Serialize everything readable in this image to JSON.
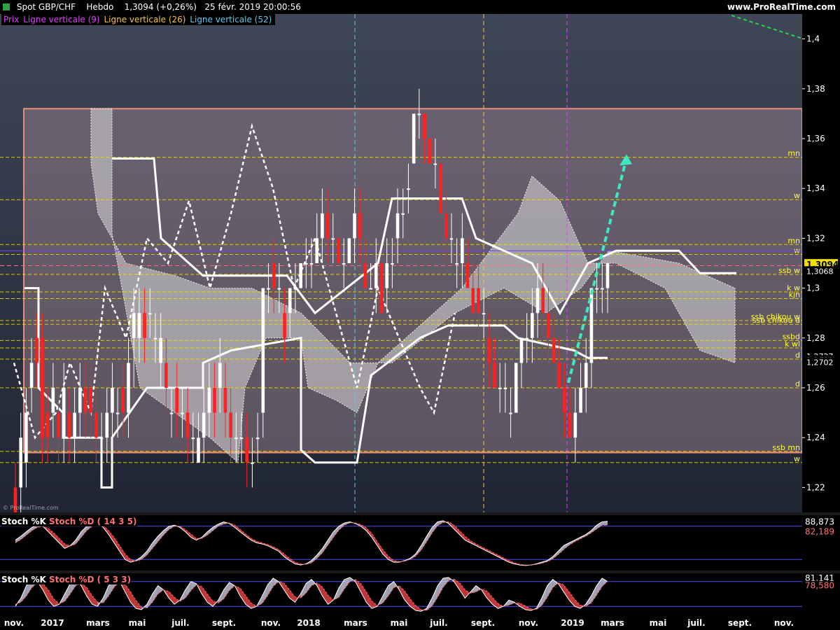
{
  "header": {
    "title": "Spot GBP/CHF",
    "period": "Hebdo",
    "last": "1,3094 (+0,26%)",
    "datetime": "25 févr. 2019 20:00:56",
    "brand": "www.ProRealTime.com"
  },
  "legend": [
    {
      "label": "Prix",
      "color": "#e040fb"
    },
    {
      "label": "Ligne verticale (9)",
      "color": "#e040fb"
    },
    {
      "label": "Ligne verticale (26)",
      "color": "#f4c542"
    },
    {
      "label": "Ligne verticale (52)",
      "color": "#5ec8f2"
    }
  ],
  "watermark": "© ProRealTime.com",
  "colors": {
    "up_candle": "#ffffff",
    "down_candle": "#ff2020",
    "box_border": "#f08a7a",
    "level_line": "#f4e000",
    "stoch_k": "#ffffff",
    "stoch_d": "#ff6060",
    "projection": "#3ee8c0"
  },
  "x_labels": [
    "nov.",
    "2017",
    "mars",
    "mai",
    "juil.",
    "sept.",
    "nov.",
    "2018",
    "mars",
    "mai",
    "juil.",
    "sept.",
    "nov.",
    "2019",
    "mars",
    "mai",
    "juil.",
    "sept.",
    "nov."
  ],
  "price_axis": {
    "ticks": [
      "1,4",
      "1,38",
      "1,36",
      "1,34",
      "1,32",
      "1,3",
      "1,28",
      "1,26",
      "1,24",
      "1,22"
    ],
    "ylim": [
      1.21,
      1.41
    ],
    "current_price_label": "1,3094",
    "side_labels": [
      "1,3068",
      "1,2727",
      "1,2711",
      "1,2702"
    ]
  },
  "level_labels": [
    {
      "text": "mn",
      "value": 1.3525
    },
    {
      "text": "w",
      "value": 1.3355
    },
    {
      "text": "mn",
      "value": 1.3175
    },
    {
      "text": "w",
      "value": 1.3135
    },
    {
      "text": "ssb w",
      "value": 1.3055
    },
    {
      "text": "k w",
      "value": 1.2985
    },
    {
      "text": "kjn",
      "value": 1.2958
    },
    {
      "text": "ssb chikou w",
      "value": 1.287
    },
    {
      "text": "ssb chikou d",
      "value": 1.2855
    },
    {
      "text": "ssbd",
      "value": 1.279
    },
    {
      "text": "k wl",
      "value": 1.276
    },
    {
      "text": "d",
      "value": 1.2715
    },
    {
      "text": "d",
      "value": 1.26
    },
    {
      "text": "ssb mn",
      "value": 1.2345
    },
    {
      "text": "w",
      "value": 1.23
    }
  ],
  "chart_data": [
    {
      "type": "candlestick",
      "title": "Spot GBP/CHF",
      "ylim": [
        1.21,
        1.41
      ],
      "box": {
        "top": 1.372,
        "bottom": 1.234
      },
      "candles": [
        [
          1.22,
          1.23,
          1.2,
          1.21
        ],
        [
          1.22,
          1.25,
          1.19,
          1.24
        ],
        [
          1.23,
          1.26,
          1.22,
          1.25
        ],
        [
          1.26,
          1.28,
          1.25,
          1.27
        ],
        [
          1.28,
          1.29,
          1.26,
          1.27
        ],
        [
          1.28,
          1.29,
          1.23,
          1.24
        ],
        [
          1.25,
          1.26,
          1.23,
          1.24
        ],
        [
          1.25,
          1.27,
          1.24,
          1.26
        ],
        [
          1.25,
          1.26,
          1.23,
          1.24
        ],
        [
          1.24,
          1.27,
          1.23,
          1.26
        ],
        [
          1.25,
          1.26,
          1.23,
          1.24
        ],
        [
          1.24,
          1.26,
          1.23,
          1.25
        ],
        [
          1.25,
          1.27,
          1.24,
          1.26
        ],
        [
          1.26,
          1.27,
          1.24,
          1.25
        ],
        [
          1.26,
          1.27,
          1.24,
          1.25
        ],
        [
          1.25,
          1.26,
          1.23,
          1.24
        ],
        [
          1.24,
          1.25,
          1.23,
          1.24
        ],
        [
          1.24,
          1.26,
          1.23,
          1.25
        ],
        [
          1.25,
          1.27,
          1.23,
          1.26
        ],
        [
          1.25,
          1.26,
          1.24,
          1.25
        ],
        [
          1.26,
          1.27,
          1.24,
          1.25
        ],
        [
          1.25,
          1.28,
          1.24,
          1.27
        ],
        [
          1.28,
          1.3,
          1.26,
          1.29
        ],
        [
          1.28,
          1.3,
          1.27,
          1.29
        ],
        [
          1.29,
          1.3,
          1.27,
          1.28
        ],
        [
          1.29,
          1.3,
          1.28,
          1.29
        ],
        [
          1.28,
          1.29,
          1.27,
          1.28
        ],
        [
          1.27,
          1.29,
          1.26,
          1.28
        ],
        [
          1.27,
          1.28,
          1.25,
          1.26
        ],
        [
          1.25,
          1.26,
          1.24,
          1.25
        ],
        [
          1.26,
          1.27,
          1.24,
          1.25
        ],
        [
          1.25,
          1.26,
          1.24,
          1.25
        ],
        [
          1.25,
          1.26,
          1.23,
          1.24
        ],
        [
          1.24,
          1.25,
          1.23,
          1.24
        ],
        [
          1.23,
          1.25,
          1.23,
          1.24
        ],
        [
          1.24,
          1.26,
          1.23,
          1.25
        ],
        [
          1.25,
          1.27,
          1.24,
          1.26
        ],
        [
          1.26,
          1.27,
          1.24,
          1.25
        ],
        [
          1.26,
          1.28,
          1.25,
          1.27
        ],
        [
          1.26,
          1.27,
          1.24,
          1.25
        ],
        [
          1.25,
          1.26,
          1.23,
          1.24
        ],
        [
          1.24,
          1.25,
          1.23,
          1.24
        ],
        [
          1.24,
          1.25,
          1.23,
          1.24
        ],
        [
          1.24,
          1.25,
          1.22,
          1.23
        ],
        [
          1.23,
          1.24,
          1.22,
          1.23
        ],
        [
          1.24,
          1.25,
          1.23,
          1.24
        ],
        [
          1.25,
          1.3,
          1.24,
          1.3
        ],
        [
          1.3,
          1.31,
          1.29,
          1.3
        ],
        [
          1.31,
          1.32,
          1.29,
          1.3
        ],
        [
          1.3,
          1.31,
          1.29,
          1.3
        ],
        [
          1.29,
          1.3,
          1.27,
          1.28
        ],
        [
          1.29,
          1.3,
          1.28,
          1.3
        ],
        [
          1.3,
          1.31,
          1.29,
          1.3
        ],
        [
          1.3,
          1.31,
          1.3,
          1.31
        ],
        [
          1.31,
          1.32,
          1.3,
          1.31
        ],
        [
          1.31,
          1.32,
          1.3,
          1.31
        ],
        [
          1.31,
          1.33,
          1.31,
          1.32
        ],
        [
          1.32,
          1.34,
          1.31,
          1.33
        ],
        [
          1.33,
          1.34,
          1.31,
          1.32
        ],
        [
          1.32,
          1.33,
          1.31,
          1.32
        ],
        [
          1.32,
          1.33,
          1.31,
          1.31
        ],
        [
          1.31,
          1.32,
          1.3,
          1.31
        ],
        [
          1.31,
          1.32,
          1.31,
          1.32
        ],
        [
          1.32,
          1.34,
          1.31,
          1.33
        ],
        [
          1.33,
          1.34,
          1.31,
          1.32
        ],
        [
          1.31,
          1.32,
          1.3,
          1.3
        ],
        [
          1.3,
          1.31,
          1.3,
          1.3
        ],
        [
          1.3,
          1.32,
          1.29,
          1.31
        ],
        [
          1.31,
          1.31,
          1.29,
          1.29
        ],
        [
          1.3,
          1.32,
          1.29,
          1.31
        ],
        [
          1.31,
          1.32,
          1.3,
          1.31
        ],
        [
          1.32,
          1.34,
          1.31,
          1.33
        ],
        [
          1.33,
          1.34,
          1.32,
          1.33
        ],
        [
          1.34,
          1.35,
          1.33,
          1.34
        ],
        [
          1.35,
          1.37,
          1.35,
          1.37
        ],
        [
          1.37,
          1.38,
          1.36,
          1.37
        ],
        [
          1.37,
          1.37,
          1.35,
          1.36
        ],
        [
          1.36,
          1.36,
          1.35,
          1.35
        ],
        [
          1.35,
          1.36,
          1.34,
          1.35
        ],
        [
          1.35,
          1.36,
          1.33,
          1.33
        ],
        [
          1.33,
          1.34,
          1.31,
          1.32
        ],
        [
          1.32,
          1.33,
          1.31,
          1.32
        ],
        [
          1.31,
          1.32,
          1.3,
          1.31
        ],
        [
          1.31,
          1.33,
          1.3,
          1.32
        ],
        [
          1.31,
          1.32,
          1.3,
          1.3
        ],
        [
          1.3,
          1.31,
          1.29,
          1.29
        ],
        [
          1.3,
          1.31,
          1.28,
          1.29
        ],
        [
          1.29,
          1.3,
          1.28,
          1.29
        ],
        [
          1.28,
          1.29,
          1.26,
          1.27
        ],
        [
          1.27,
          1.28,
          1.26,
          1.26
        ],
        [
          1.26,
          1.27,
          1.25,
          1.26
        ],
        [
          1.26,
          1.27,
          1.25,
          1.26
        ],
        [
          1.25,
          1.26,
          1.24,
          1.25
        ],
        [
          1.25,
          1.27,
          1.25,
          1.27
        ],
        [
          1.27,
          1.28,
          1.26,
          1.28
        ],
        [
          1.28,
          1.29,
          1.27,
          1.28
        ],
        [
          1.28,
          1.3,
          1.27,
          1.29
        ],
        [
          1.29,
          1.31,
          1.28,
          1.3
        ],
        [
          1.3,
          1.31,
          1.28,
          1.29
        ],
        [
          1.29,
          1.3,
          1.27,
          1.28
        ],
        [
          1.28,
          1.29,
          1.27,
          1.27
        ],
        [
          1.27,
          1.28,
          1.26,
          1.26
        ],
        [
          1.26,
          1.27,
          1.24,
          1.25
        ],
        [
          1.25,
          1.26,
          1.24,
          1.24
        ],
        [
          1.24,
          1.26,
          1.23,
          1.25
        ],
        [
          1.25,
          1.27,
          1.25,
          1.26
        ],
        [
          1.26,
          1.28,
          1.25,
          1.27
        ],
        [
          1.27,
          1.3,
          1.26,
          1.3
        ],
        [
          1.3,
          1.31,
          1.29,
          1.3
        ],
        [
          1.3,
          1.31,
          1.29,
          1.3
        ],
        [
          1.3,
          1.31,
          1.29,
          1.31
        ]
      ],
      "projection": [
        [
          1.262,
          1.352
        ]
      ]
    },
    {
      "type": "line",
      "title": "Stoch %K Stoch %D ( 14 3 5)",
      "series": [
        {
          "name": "Stoch %K",
          "color": "#ffffff"
        },
        {
          "name": "Stoch %D",
          "color": "#ff6060"
        }
      ],
      "ylim": [
        0,
        100
      ],
      "last_values": [
        "88,873",
        "82,189"
      ],
      "levels": [
        20,
        80
      ],
      "k": [
        55,
        62,
        70,
        78,
        82,
        80,
        70,
        60,
        50,
        40,
        45,
        55,
        70,
        80,
        85,
        86,
        78,
        65,
        50,
        35,
        20,
        15,
        18,
        25,
        35,
        50,
        62,
        72,
        80,
        82,
        78,
        70,
        60,
        55,
        60,
        70,
        78,
        84,
        88,
        85,
        78,
        70,
        62,
        55,
        50,
        48,
        45,
        40,
        35,
        25,
        18,
        12,
        10,
        12,
        18,
        28,
        40,
        55,
        70,
        80,
        86,
        88,
        85,
        80,
        72,
        60,
        45,
        30,
        20,
        15,
        15,
        18,
        22,
        30,
        45,
        62,
        78,
        88,
        90,
        85,
        75,
        65,
        55,
        50,
        45,
        40,
        35,
        30,
        25,
        20,
        15,
        12,
        10,
        9,
        10,
        12,
        15,
        18,
        25,
        35,
        45,
        50,
        55,
        60,
        65,
        72,
        82,
        88,
        89
      ],
      "d": [
        50,
        56,
        64,
        72,
        78,
        80,
        76,
        68,
        58,
        48,
        44,
        48,
        60,
        72,
        80,
        84,
        82,
        72,
        60,
        45,
        30,
        20,
        17,
        20,
        28,
        40,
        52,
        64,
        74,
        80,
        80,
        74,
        66,
        58,
        58,
        64,
        72,
        80,
        84,
        86,
        82,
        74,
        66,
        58,
        53,
        50,
        47,
        43,
        38,
        30,
        22,
        15,
        12,
        11,
        14,
        22,
        32,
        46,
        60,
        73,
        82,
        86,
        86,
        83,
        77,
        67,
        52,
        38,
        26,
        18,
        16,
        17,
        20,
        26,
        37,
        52,
        68,
        81,
        87,
        88,
        82,
        72,
        62,
        54,
        48,
        43,
        38,
        33,
        28,
        23,
        18,
        14,
        11,
        10,
        10,
        11,
        13,
        16,
        21,
        29,
        38,
        46,
        52,
        57,
        62,
        68,
        75,
        82,
        82
      ]
    },
    {
      "type": "line",
      "title": "Stoch %K Stoch %D ( 5 3 3)",
      "series": [
        {
          "name": "Stoch %K",
          "color": "#ffffff"
        },
        {
          "name": "Stoch %D",
          "color": "#ff6060"
        }
      ],
      "ylim": [
        0,
        100
      ],
      "last_values": [
        "81,141",
        "78,580"
      ],
      "levels": [
        20,
        80
      ],
      "k": [
        20,
        40,
        70,
        85,
        80,
        60,
        35,
        20,
        25,
        50,
        75,
        85,
        70,
        45,
        25,
        20,
        40,
        70,
        88,
        80,
        55,
        30,
        15,
        12,
        25,
        50,
        70,
        60,
        40,
        25,
        35,
        60,
        80,
        75,
        50,
        30,
        20,
        35,
        60,
        78,
        70,
        45,
        25,
        15,
        20,
        45,
        72,
        88,
        80,
        60,
        40,
        30,
        50,
        75,
        85,
        70,
        45,
        25,
        35,
        65,
        85,
        90,
        80,
        55,
        30,
        15,
        20,
        45,
        70,
        80,
        60,
        35,
        20,
        10,
        8,
        15,
        40,
        70,
        88,
        90,
        80,
        60,
        40,
        55,
        70,
        60,
        40,
        25,
        15,
        20,
        35,
        30,
        20,
        12,
        10,
        15,
        40,
        70,
        85,
        75,
        55,
        35,
        20,
        15,
        25,
        45,
        70,
        88,
        80
      ],
      "d": [
        25,
        30,
        45,
        65,
        78,
        75,
        60,
        38,
        26,
        32,
        50,
        70,
        76,
        66,
        46,
        30,
        28,
        45,
        66,
        80,
        74,
        55,
        34,
        18,
        16,
        30,
        50,
        60,
        56,
        42,
        32,
        40,
        58,
        72,
        68,
        50,
        33,
        28,
        38,
        58,
        70,
        64,
        46,
        28,
        20,
        27,
        46,
        68,
        80,
        76,
        60,
        43,
        40,
        52,
        70,
        77,
        67,
        47,
        35,
        42,
        62,
        80,
        85,
        75,
        55,
        33,
        22,
        28,
        45,
        65,
        70,
        57,
        38,
        22,
        12,
        10,
        21,
        42,
        66,
        82,
        86,
        77,
        60,
        52,
        55,
        62,
        57,
        42,
        27,
        20,
        23,
        28,
        28,
        21,
        14,
        12,
        22,
        42,
        65,
        77,
        72,
        55,
        37,
        23,
        20,
        28,
        47,
        68,
        81
      ]
    }
  ]
}
